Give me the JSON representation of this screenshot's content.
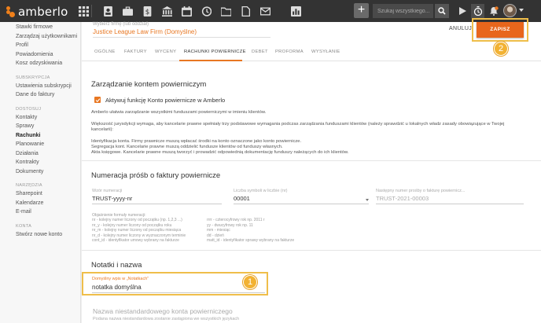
{
  "app": {
    "logo_text": "amberlo",
    "search_placeholder": "Szukaj wszystkiego..."
  },
  "colors": {
    "accent": "#e87722",
    "highlight": "#efbe4a",
    "topbar": "#333333"
  },
  "topbar_icons": [
    "grid-icon",
    "contacts-icon",
    "briefcase-icon",
    "invoice-icon",
    "bank-icon",
    "calendar-icon",
    "history-icon",
    "folder-icon",
    "document-icon",
    "mail-icon",
    "reports-icon"
  ],
  "sidebar": {
    "items_top": [
      "Stawki firmowe",
      "Zarządzaj użytkownikami",
      "Profil",
      "Powiadomienia",
      "Kosz odzyskiwania"
    ],
    "sections": [
      {
        "title": "SUBSKRYPCJA",
        "items": [
          "Ustawienia subskrypcji",
          "Dane do faktury"
        ]
      },
      {
        "title": "DOSTOSUJ",
        "items": [
          "Kontakty",
          "Sprawy",
          "Rachunki",
          "Planowanie",
          "Działania",
          "Kontrakty",
          "Dokumenty"
        ]
      },
      {
        "title": "NARZĘDZIA",
        "items": [
          "Sharepoint",
          "Kalendarze",
          "E-mail"
        ]
      },
      {
        "title": "KONTA",
        "items": [
          "Stwórz nowe konto"
        ]
      }
    ],
    "active": "Rachunki"
  },
  "header": {
    "firm_label": "Wybierz firmę (lub oddział)",
    "firm_value": "Justice League Law Firm (Domyślne)",
    "cancel_label": "ANULUJ",
    "save_label": "ZAPISZ",
    "step_save": "2",
    "step_note": "1"
  },
  "tabs": [
    "OGÓLNE",
    "FAKTURY",
    "WYCENY",
    "RACHUNKI POWIERNICZE",
    "DEBET",
    "PROFORMA",
    "WYSYŁANIE"
  ],
  "active_tab": "RACHUNKI POWIERNICZE",
  "trust": {
    "title": "Zarządzanie kontem powierniczym",
    "checkbox_label": "Aktywuj funkcję Konto powiernicze w Amberlo",
    "checked": true,
    "p1": "Amberlo ułatwia zarządzanie wszystkimi funduszami powierniczymi w imieniu klientów.",
    "p2": "Większość jurysdykcji wymaga, aby kancelarie prawne spełniały trzy podstawowe wymagania podczas zarządzania funduszami klientów (należy sprawdzić u lokalnych władz zasady obowiązujące w Twojej kancelarii):",
    "p3a": "Identyfikacja konta. Firmy prawnicze muszą wpłacać środki na konto oznaczone jako konto powiernicze.",
    "p3b": "Segregacja kont. Kancelarie prawne muszą oddzielić fundusze klientów od funduszy własnych.",
    "p3c": "Akta księgowe. Kancelarie prawne muszą tworzyć i prowadzić odpowiednią dokumentację funduszy należących do ich klientów."
  },
  "numbering": {
    "title": "Numeracja próśb o faktury powiernicze",
    "pattern_label": "Wzór numeracji",
    "pattern_value": "TRUST-yyyy-nr",
    "digits_label": "Liczba symboli w liczbie (nr)",
    "digits_value": "00001",
    "next_label": "Następny numer prośby o fakturę powiernicz...",
    "next_value": "TRUST-2021-00003",
    "formula_title": "Objaśnienie formuły numeracji:",
    "formula_left": [
      "nr - kolejny numer liczony od początku (np. 1,2,3 ...)",
      "nr_y - kolejny numer liczony od początku roku",
      "nr_m - kolejny numer liczony od początku miesiąca",
      "nr_d - kolejny numer liczony w wyznaczonym terminie",
      "cont_id - identyfikator umowy wybrany na fakturze"
    ],
    "formula_right": [
      "rrrr - czterocyfrowy rok np. 2011 r",
      "yy - dwucyfrowy rok np. 11",
      "mm - miesiąc",
      "dd - dzień",
      "matt_id - identyfikator sprawy wybrany na fakturze"
    ]
  },
  "notes": {
    "title": "Notatki i nazwa",
    "default_label": "Domyślny wpis w „Notatkach”",
    "default_value": "notatka domyślna",
    "custom_title": "Nazwa niestandardowego konta powierniczego",
    "custom_sub": "Podana nazwa niestandardowa zostanie zastąpiona we wszystkich językach"
  }
}
